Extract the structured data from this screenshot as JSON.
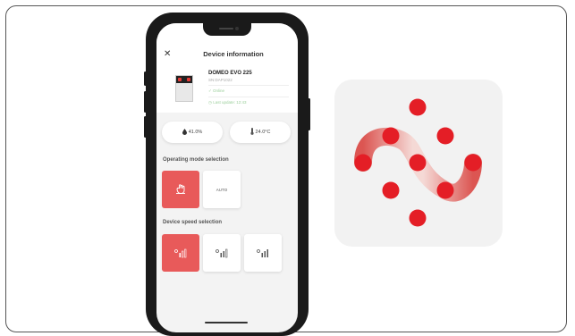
{
  "header": {
    "title": "Device information"
  },
  "device": {
    "name": "DOMEO EVO 225",
    "serial": "SN:DAP1022",
    "status": "Online",
    "last_update": "Last update: 12:43"
  },
  "readings": {
    "humidity": "41.0%",
    "temperature": "24.0°C"
  },
  "operating_mode": {
    "title": "Operating mode selection",
    "options": [
      {
        "label": "",
        "active": true
      },
      {
        "label": "AUTO",
        "active": false
      }
    ]
  },
  "device_speed": {
    "title": "Device speed selection",
    "options": [
      {
        "level": 1,
        "active": true
      },
      {
        "level": 2,
        "active": false
      },
      {
        "level": 3,
        "active": false
      }
    ]
  },
  "colors": {
    "accent": "#e85a5a",
    "logo_dot": "#e41e26",
    "online_green": "#9ccf9c"
  },
  "icons": [
    "close-icon",
    "drop-icon",
    "thermometer-icon",
    "hand-icon",
    "fan-speed-1-icon",
    "fan-speed-2-icon",
    "fan-speed-3-icon",
    "check-icon",
    "clock-icon"
  ]
}
